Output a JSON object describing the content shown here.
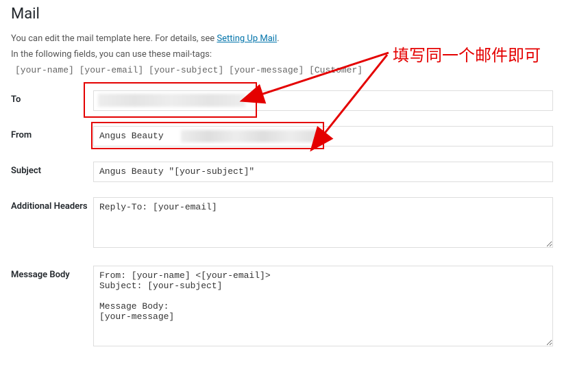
{
  "heading": "Mail",
  "description_prefix": "You can edit the mail template here. For details, see ",
  "description_link": "Setting Up Mail",
  "description_suffix": ".",
  "description_line2": "In the following fields, you can use these mail-tags:",
  "mail_tags": "[your-name] [your-email] [your-subject] [your-message] [Customer]",
  "fields": {
    "to": {
      "label": "To",
      "value": ""
    },
    "from": {
      "label": "From",
      "value": "Angus Beauty"
    },
    "subject": {
      "label": "Subject",
      "value": "Angus Beauty \"[your-subject]\""
    },
    "additional_headers": {
      "label": "Additional Headers",
      "value": "Reply-To: [your-email]"
    },
    "message_body": {
      "label": "Message Body",
      "value": "From: [your-name] <[your-email]>\nSubject: [your-subject]\n\nMessage Body:\n[your-message]"
    }
  },
  "annotation": {
    "text": "填写同一个邮件即可",
    "highlight_color": "#e40000"
  }
}
